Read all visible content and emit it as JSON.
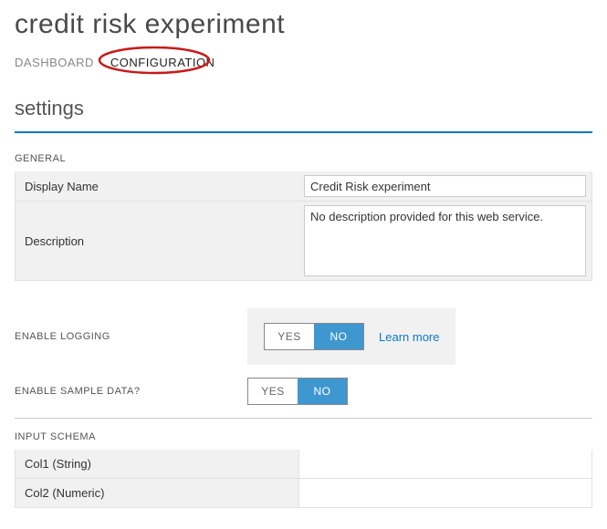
{
  "page_title": "credit risk experiment",
  "tabs": {
    "dashboard": "DASHBOARD",
    "configuration": "CONFIGURATION"
  },
  "settings_title": "settings",
  "general": {
    "group_label": "GENERAL",
    "display_name_label": "Display Name",
    "display_name_value": "Credit Risk experiment",
    "description_label": "Description",
    "description_value": "No description provided for this web service."
  },
  "logging": {
    "label": "ENABLE LOGGING",
    "yes": "YES",
    "no": "NO",
    "selected": "NO",
    "learn_more": "Learn more"
  },
  "sample_data": {
    "label": "ENABLE SAMPLE DATA?",
    "yes": "YES",
    "no": "NO",
    "selected": "NO"
  },
  "input_schema": {
    "group_label": "INPUT SCHEMA",
    "rows": [
      "Col1 (String)",
      "Col2 (Numeric)"
    ]
  }
}
